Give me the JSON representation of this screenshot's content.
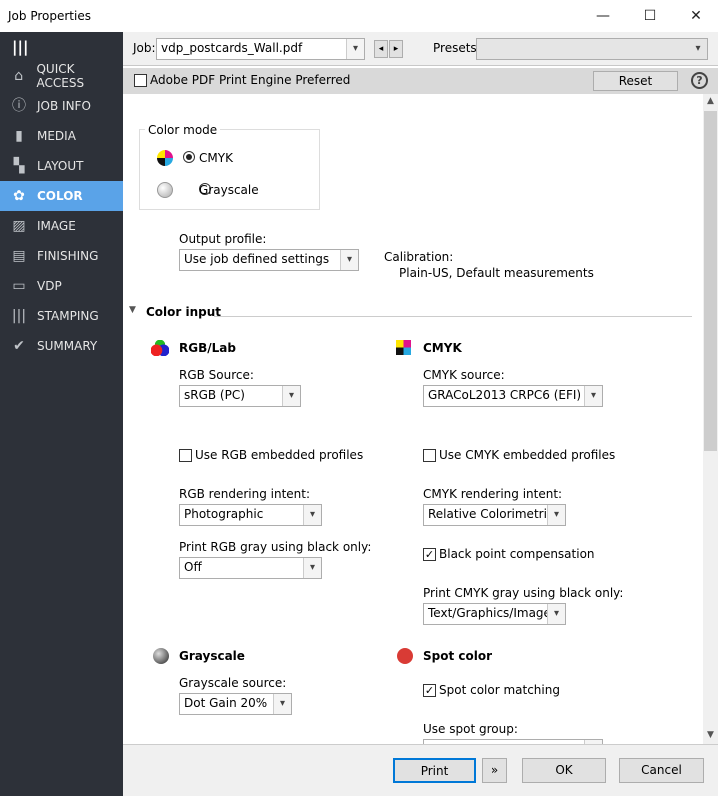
{
  "window": {
    "title": "Job Properties",
    "minimize": "—",
    "maximize": "☐",
    "close": "✕"
  },
  "sidebar": {
    "items": [
      {
        "label": "QUICK ACCESS",
        "icon": "⌂"
      },
      {
        "label": "JOB INFO",
        "icon": "ⓘ"
      },
      {
        "label": "MEDIA",
        "icon": "▮"
      },
      {
        "label": "LAYOUT",
        "icon": "▚"
      },
      {
        "label": "COLOR",
        "icon": "✿"
      },
      {
        "label": "IMAGE",
        "icon": "▨"
      },
      {
        "label": "FINISHING",
        "icon": "▤"
      },
      {
        "label": "VDP",
        "icon": "▭"
      },
      {
        "label": "STAMPING",
        "icon": "|||"
      },
      {
        "label": "SUMMARY",
        "icon": "✔"
      }
    ],
    "selected": "COLOR",
    "menu_icon": "|||"
  },
  "toolbar": {
    "job_label": "Job:",
    "job_value": "vdp_postcards_Wall.pdf",
    "presets_label": "Presets:",
    "presets_value": "",
    "prev": "◂",
    "next": "▸"
  },
  "bar": {
    "apdf_label": "Adobe PDF Print Engine Preferred",
    "apdf_checked": false,
    "reset": "Reset",
    "help": "?"
  },
  "color_mode": {
    "legend": "Color mode",
    "options": [
      "CMYK",
      "Grayscale"
    ],
    "selected": "CMYK"
  },
  "output": {
    "label": "Output profile:",
    "value": "Use job defined settings",
    "calibration_label": "Calibration:",
    "calibration_value": "Plain-US, Default measurements"
  },
  "color_input": {
    "header": "Color input",
    "rgb": {
      "title": "RGB/Lab",
      "source_label": "RGB Source:",
      "source_value": "sRGB (PC)",
      "embedded_label": "Use RGB embedded profiles",
      "embedded_checked": false,
      "intent_label": "RGB rendering intent:",
      "intent_value": "Photographic",
      "gray_label": "Print RGB gray using black only:",
      "gray_value": "Off"
    },
    "cmyk": {
      "title": "CMYK",
      "source_label": "CMYK source:",
      "source_value": "GRACoL2013 CRPC6 (EFI)",
      "embedded_label": "Use CMYK embedded profiles",
      "embedded_checked": false,
      "intent_label": "CMYK rendering intent:",
      "intent_value": "Relative Colorimetric",
      "bpc_label": "Black point compensation",
      "bpc_checked": true,
      "gray_label": "Print CMYK gray using black only:",
      "gray_value": "Text/Graphics/Images"
    },
    "grayscale": {
      "title": "Grayscale",
      "source_label": "Grayscale source:",
      "source_value": "Dot Gain 20%"
    },
    "spot": {
      "title": "Spot color",
      "matching_label": "Spot color matching",
      "matching_checked": true,
      "group_label": "Use spot group:",
      "group_value": ""
    }
  },
  "footer": {
    "print": "Print",
    "more": "»",
    "ok": "OK",
    "cancel": "Cancel"
  },
  "colors": {
    "sidebar_bg": "#2d3139",
    "selected_bg": "#5aa3e8",
    "spot_red": "#d93b35"
  }
}
